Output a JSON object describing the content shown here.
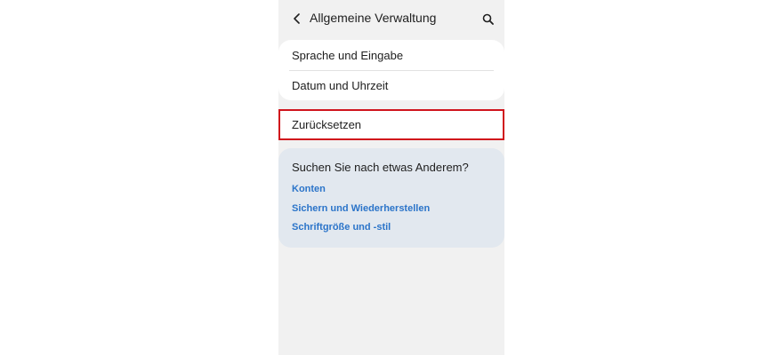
{
  "header": {
    "title": "Allgemeine Verwaltung",
    "back_icon": "chevron-left-icon",
    "search_icon": "search-icon"
  },
  "menu": {
    "items": [
      {
        "label": "Sprache und Eingabe"
      },
      {
        "label": "Datum und Uhrzeit"
      }
    ],
    "reset_label": "Zurücksetzen",
    "highlight_color": "#d0141c"
  },
  "suggestions": {
    "title": "Suchen Sie nach etwas Anderem?",
    "links": [
      {
        "label": "Konten"
      },
      {
        "label": "Sichern und Wiederherstellen"
      },
      {
        "label": "Schriftgröße und -stil"
      }
    ],
    "link_color": "#2b74c9",
    "background_color": "#e2e8ef"
  }
}
